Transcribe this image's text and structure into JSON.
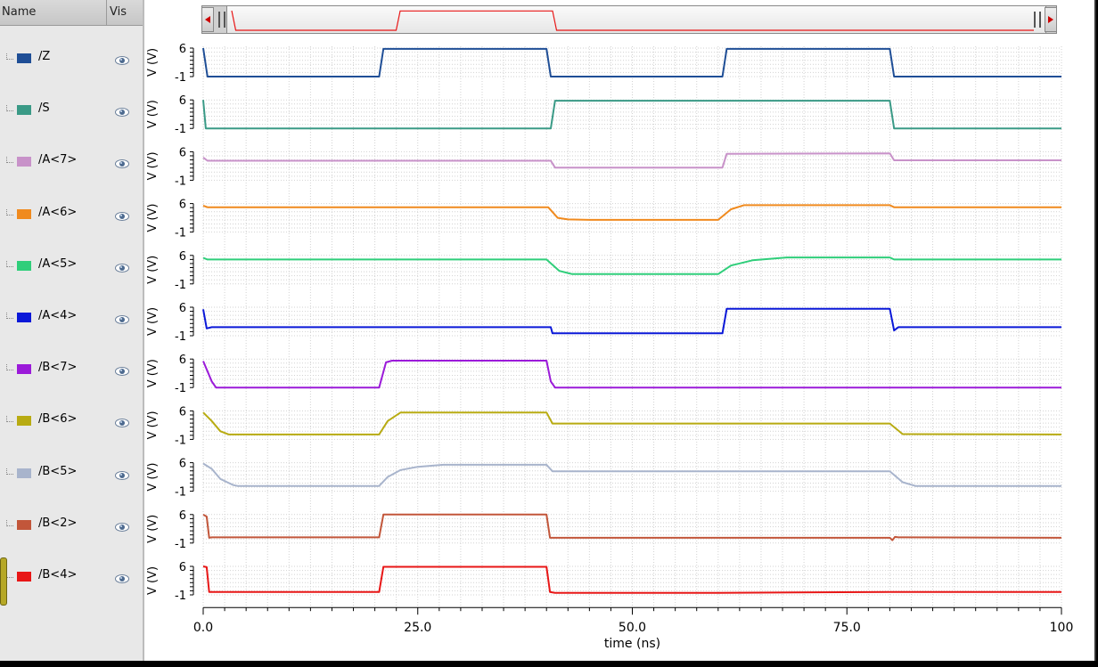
{
  "list_header": {
    "name": "Name",
    "vis": "Vis"
  },
  "signals": [
    {
      "name": "/Z",
      "color": "#1f4e96"
    },
    {
      "name": "/S",
      "color": "#3a9a86"
    },
    {
      "name": "/A<7>",
      "color": "#c892c9"
    },
    {
      "name": "/A<6>",
      "color": "#f08a1e"
    },
    {
      "name": "/A<5>",
      "color": "#2fce7a"
    },
    {
      "name": "/A<4>",
      "color": "#0a18d8"
    },
    {
      "name": "/B<7>",
      "color": "#9b1ad9"
    },
    {
      "name": "/B<6>",
      "color": "#b8ab12"
    },
    {
      "name": "/B<5>",
      "color": "#a8b4cc"
    },
    {
      "name": "/B<2>",
      "color": "#c2563a"
    },
    {
      "name": "/B<4>",
      "color": "#e81616"
    }
  ],
  "chart_data": {
    "type": "line",
    "xlabel": "time (ns)",
    "ylabel": "V (V)",
    "xlim": [
      0,
      100
    ],
    "ylim": [
      -1,
      6
    ],
    "x_ticks": [
      "0.0",
      "25.0",
      "50.0",
      "75.0",
      "100"
    ],
    "y_ticks": [
      "6",
      "-1"
    ],
    "grid": true,
    "series": [
      {
        "name": "/Z",
        "points": [
          [
            0,
            6
          ],
          [
            0.5,
            -1
          ],
          [
            20.5,
            -1
          ],
          [
            21,
            5.8
          ],
          [
            40,
            5.8
          ],
          [
            40.5,
            -1
          ],
          [
            60.5,
            -1
          ],
          [
            61,
            5.8
          ],
          [
            80,
            5.8
          ],
          [
            80.5,
            -1
          ],
          [
            100,
            -1
          ]
        ]
      },
      {
        "name": "/S",
        "points": [
          [
            0,
            6
          ],
          [
            0.3,
            -1
          ],
          [
            40.5,
            -1
          ],
          [
            41,
            5.8
          ],
          [
            80,
            5.8
          ],
          [
            80.5,
            -1
          ],
          [
            100,
            -1
          ]
        ]
      },
      {
        "name": "/A<7>",
        "points": [
          [
            0,
            4.6
          ],
          [
            0.5,
            3.8
          ],
          [
            40.5,
            3.8
          ],
          [
            41,
            2.1
          ],
          [
            60.5,
            2.1
          ],
          [
            61,
            5.5
          ],
          [
            80,
            5.6
          ],
          [
            80.5,
            3.9
          ],
          [
            100,
            3.9
          ]
        ]
      },
      {
        "name": "/A<6>",
        "points": [
          [
            0,
            5.5
          ],
          [
            0.5,
            5.1
          ],
          [
            40.2,
            5.1
          ],
          [
            41.3,
            2.5
          ],
          [
            42.5,
            2.1
          ],
          [
            45,
            2
          ],
          [
            60,
            2
          ],
          [
            61.5,
            4.6
          ],
          [
            63,
            5.6
          ],
          [
            80,
            5.6
          ],
          [
            80.5,
            5.1
          ],
          [
            100,
            5.1
          ]
        ]
      },
      {
        "name": "/A<5>",
        "points": [
          [
            0,
            5.4
          ],
          [
            0.5,
            5.0
          ],
          [
            40,
            5.0
          ],
          [
            41.5,
            2.2
          ],
          [
            43,
            1.4
          ],
          [
            46,
            1.4
          ],
          [
            60,
            1.4
          ],
          [
            61.5,
            3.5
          ],
          [
            64,
            4.8
          ],
          [
            68,
            5.5
          ],
          [
            80,
            5.5
          ],
          [
            80.5,
            5.0
          ],
          [
            100,
            5.0
          ]
        ]
      },
      {
        "name": "/A<4>",
        "points": [
          [
            0,
            5.5
          ],
          [
            0.4,
            0.8
          ],
          [
            1,
            1.1
          ],
          [
            40.5,
            1.1
          ],
          [
            40.7,
            -0.4
          ],
          [
            41.5,
            -0.4
          ],
          [
            60.5,
            -0.4
          ],
          [
            61,
            5.6
          ],
          [
            80,
            5.6
          ],
          [
            80.5,
            0.3
          ],
          [
            81,
            1.1
          ],
          [
            100,
            1.1
          ]
        ]
      },
      {
        "name": "/B<7>",
        "points": [
          [
            0,
            5.5
          ],
          [
            1,
            0.5
          ],
          [
            1.5,
            -1
          ],
          [
            20.5,
            -1
          ],
          [
            21.3,
            5.2
          ],
          [
            22,
            5.6
          ],
          [
            40,
            5.6
          ],
          [
            40.5,
            0.5
          ],
          [
            41,
            -1
          ],
          [
            100,
            -1
          ]
        ]
      },
      {
        "name": "/B<6>",
        "points": [
          [
            0,
            5.6
          ],
          [
            1,
            3.5
          ],
          [
            2,
            1
          ],
          [
            3,
            0.2
          ],
          [
            20.5,
            0.2
          ],
          [
            21.5,
            3.5
          ],
          [
            23,
            5.6
          ],
          [
            40,
            5.6
          ],
          [
            40.7,
            2.9
          ],
          [
            41,
            2.9
          ],
          [
            80,
            2.9
          ],
          [
            81.5,
            0.3
          ],
          [
            100,
            0.2
          ]
        ]
      },
      {
        "name": "/B<5>",
        "points": [
          [
            0,
            5.8
          ],
          [
            1,
            4.5
          ],
          [
            2,
            2
          ],
          [
            3.5,
            0.5
          ],
          [
            4,
            0.3
          ],
          [
            20.5,
            0.3
          ],
          [
            21.5,
            2.5
          ],
          [
            23,
            4.2
          ],
          [
            25,
            5.0
          ],
          [
            28,
            5.5
          ],
          [
            40,
            5.5
          ],
          [
            40.7,
            3.9
          ],
          [
            41,
            3.9
          ],
          [
            80,
            3.9
          ],
          [
            81.5,
            1.2
          ],
          [
            83,
            0.3
          ],
          [
            100,
            0.3
          ]
        ]
      },
      {
        "name": "/B<2>",
        "points": [
          [
            0,
            6
          ],
          [
            0.4,
            5.5
          ],
          [
            0.7,
            0.3
          ],
          [
            1,
            0.4
          ],
          [
            20.5,
            0.4
          ],
          [
            21,
            6
          ],
          [
            40,
            6
          ],
          [
            40.4,
            0.3
          ],
          [
            80,
            0.3
          ],
          [
            80.3,
            -0.3
          ],
          [
            80.6,
            0.5
          ],
          [
            81,
            0.4
          ],
          [
            100,
            0.3
          ]
        ]
      },
      {
        "name": "/B<4>",
        "points": [
          [
            0,
            6
          ],
          [
            0.4,
            5.8
          ],
          [
            0.7,
            -0.3
          ],
          [
            1,
            -0.3
          ],
          [
            20.5,
            -0.3
          ],
          [
            21,
            5.9
          ],
          [
            40,
            5.9
          ],
          [
            40.4,
            -0.3
          ],
          [
            41,
            -0.5
          ],
          [
            60,
            -0.5
          ],
          [
            80,
            -0.3
          ],
          [
            100,
            -0.3
          ]
        ]
      }
    ]
  },
  "overview": {
    "points": [
      [
        0,
        6
      ],
      [
        0.5,
        -1
      ],
      [
        20.5,
        -1
      ],
      [
        21,
        5.9
      ],
      [
        40,
        5.9
      ],
      [
        40.5,
        -1
      ],
      [
        100,
        -1
      ]
    ]
  }
}
